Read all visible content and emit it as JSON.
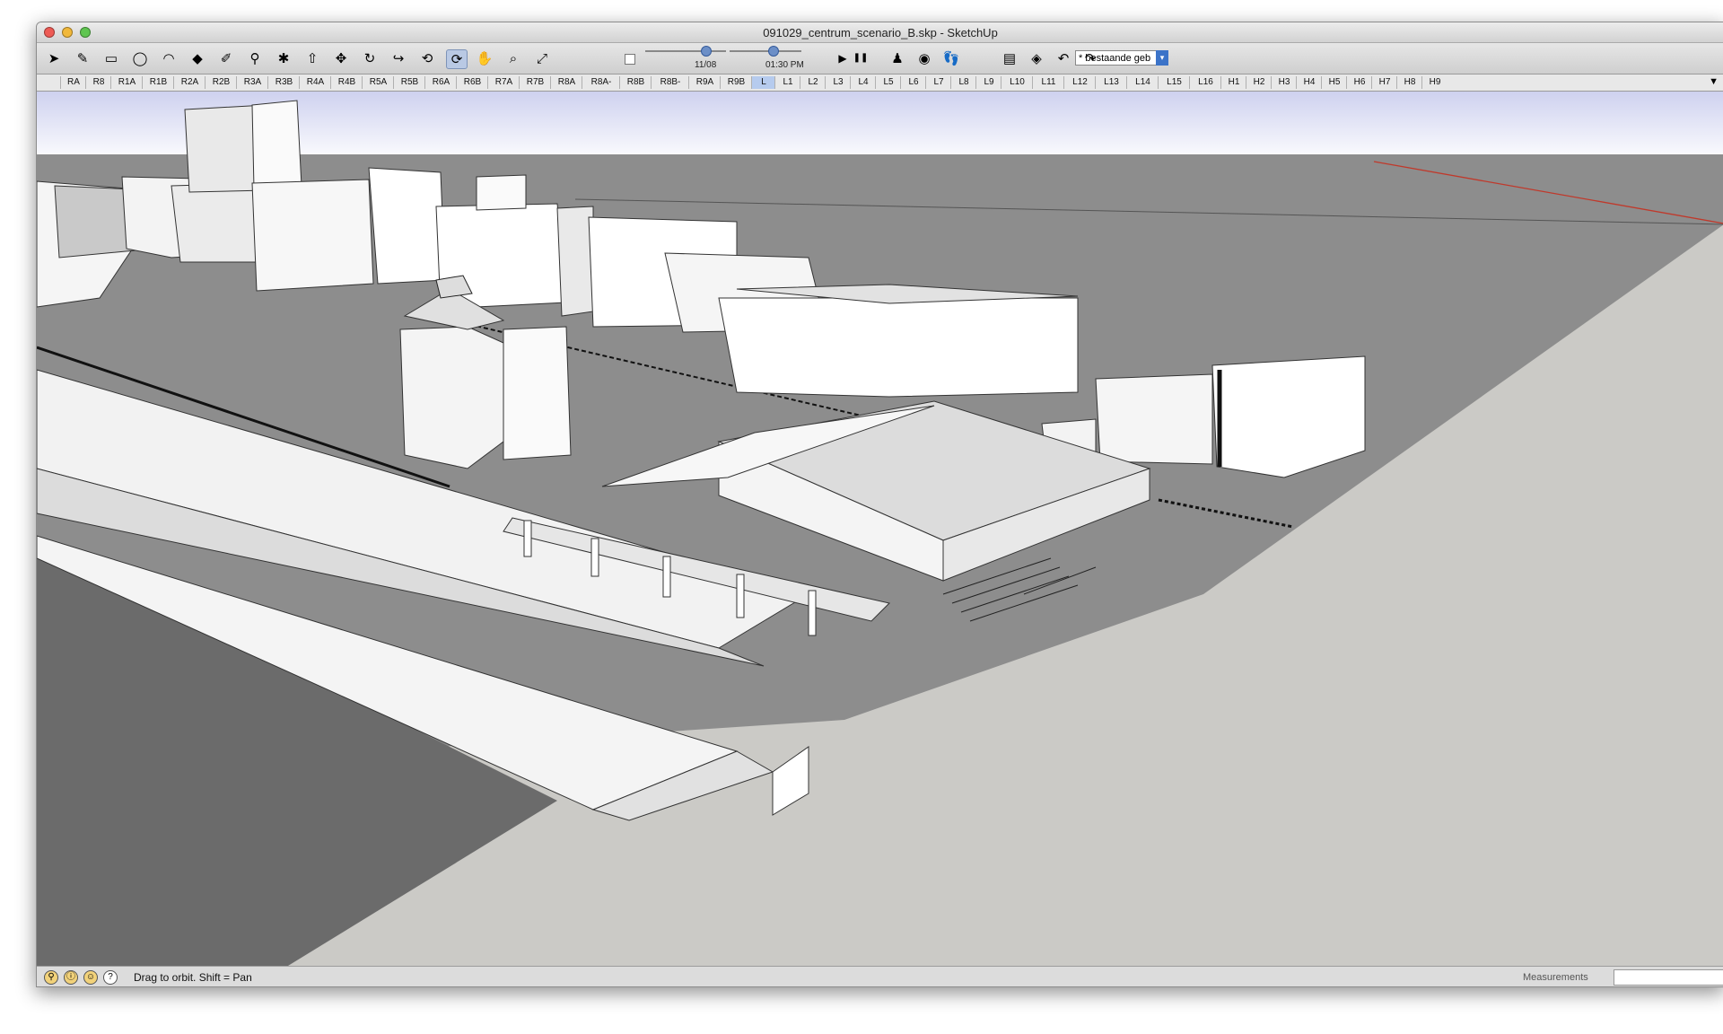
{
  "window": {
    "title": "091029_centrum_scenario_B.skp - SketchUp"
  },
  "toolbar": {
    "tools": [
      {
        "name": "select-tool-icon",
        "glyph": "➤"
      },
      {
        "name": "pencil-tool-icon",
        "glyph": "✎"
      },
      {
        "name": "rectangle-tool-icon",
        "glyph": "▭"
      },
      {
        "name": "circle-tool-icon",
        "glyph": "◯"
      },
      {
        "name": "arc-tool-icon",
        "glyph": "◠"
      },
      {
        "name": "paint-bucket-icon",
        "glyph": "◆"
      },
      {
        "name": "eraser-tool-icon",
        "glyph": "✐"
      },
      {
        "name": "tape-measure-icon",
        "glyph": "⚲"
      },
      {
        "name": "paint-tool-icon",
        "glyph": "✱"
      },
      {
        "name": "push-pull-icon",
        "glyph": "⇧"
      },
      {
        "name": "move-tool-icon",
        "glyph": "✥"
      },
      {
        "name": "rotate-tool-icon",
        "glyph": "↻"
      },
      {
        "name": "follow-me-icon",
        "glyph": "↪"
      },
      {
        "name": "offset-tool-icon",
        "glyph": "⟲"
      },
      {
        "name": "orbit-tool-icon",
        "glyph": "⟳"
      },
      {
        "name": "pan-tool-icon",
        "glyph": "✋"
      },
      {
        "name": "zoom-tool-icon",
        "glyph": "⌕"
      },
      {
        "name": "zoom-extents-icon",
        "glyph": "⤢"
      }
    ],
    "shadow_toggle_icon": "checkbox-icon",
    "date_label": "11/08",
    "time_label": "01:30 PM",
    "play_icon": "▶",
    "pause_icon": "❚❚",
    "walk_tools": [
      {
        "name": "position-camera-icon",
        "glyph": "♟"
      },
      {
        "name": "look-around-icon",
        "glyph": "◉"
      },
      {
        "name": "walk-tool-icon",
        "glyph": "👣"
      }
    ],
    "layer_value": "* bestaande geb",
    "layer_arrow": "▾",
    "right_tools": [
      {
        "name": "component-icon",
        "glyph": "▤"
      },
      {
        "name": "section-plane-icon",
        "glyph": "◈"
      },
      {
        "name": "undo-icon",
        "glyph": "↶"
      },
      {
        "name": "redo-icon",
        "glyph": "↷"
      }
    ]
  },
  "scenes": {
    "tabs": [
      "RA",
      "R8",
      "R1A",
      "R1B",
      "R2A",
      "R2B",
      "R3A",
      "R3B",
      "R4A",
      "R4B",
      "R5A",
      "R5B",
      "R6A",
      "R6B",
      "R7A",
      "R7B",
      "R8A",
      "R8A-",
      "R8B",
      "R8B-",
      "R9A",
      "R9B",
      "L",
      "L1",
      "L2",
      "L3",
      "L4",
      "L5",
      "L6",
      "L7",
      "L8",
      "L9",
      "L10",
      "L11",
      "L12",
      "L13",
      "L14",
      "L15",
      "L16",
      "H1",
      "H2",
      "H3",
      "H4",
      "H5",
      "H6",
      "H7",
      "H8",
      "H9"
    ],
    "active": "L",
    "more_icon": "▼"
  },
  "colors": {
    "sky_top": "#ced1ef",
    "sky_bottom": "#ffffff",
    "ground": "#cbcac6",
    "plaza": "#8d8d8d",
    "red_axis": "#c0392b"
  },
  "status": {
    "icons": [
      "geo-location-icon",
      "credits-icon",
      "user-icon",
      "help-icon"
    ],
    "icon_glyphs": [
      "⚲",
      "ⓘ",
      "☺",
      "?"
    ],
    "text": "Drag to orbit.  Shift = Pan",
    "measurements_label": "Measurements"
  }
}
